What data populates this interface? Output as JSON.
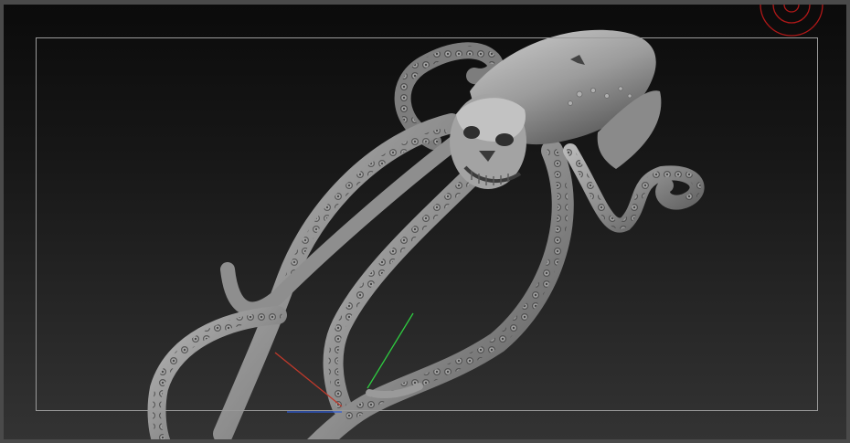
{
  "app": {
    "kind": "3d-sculpt-viewport"
  },
  "viewport": {
    "background_top": "#0b0b0b",
    "background_bottom": "#333333",
    "frame_color": "#9a9a9a",
    "border_color": "#4a4a4a"
  },
  "model": {
    "subject_icon": "octopus-sculpt",
    "material_color": "#8c8c8c"
  },
  "axis_gizmo": {
    "x_color": "#c0392b",
    "y_color": "#2ecc40",
    "z_color": "#2d5bd8"
  },
  "navigation_widget": {
    "icon": "rotate-orbit-icon",
    "color": "#b01818"
  }
}
